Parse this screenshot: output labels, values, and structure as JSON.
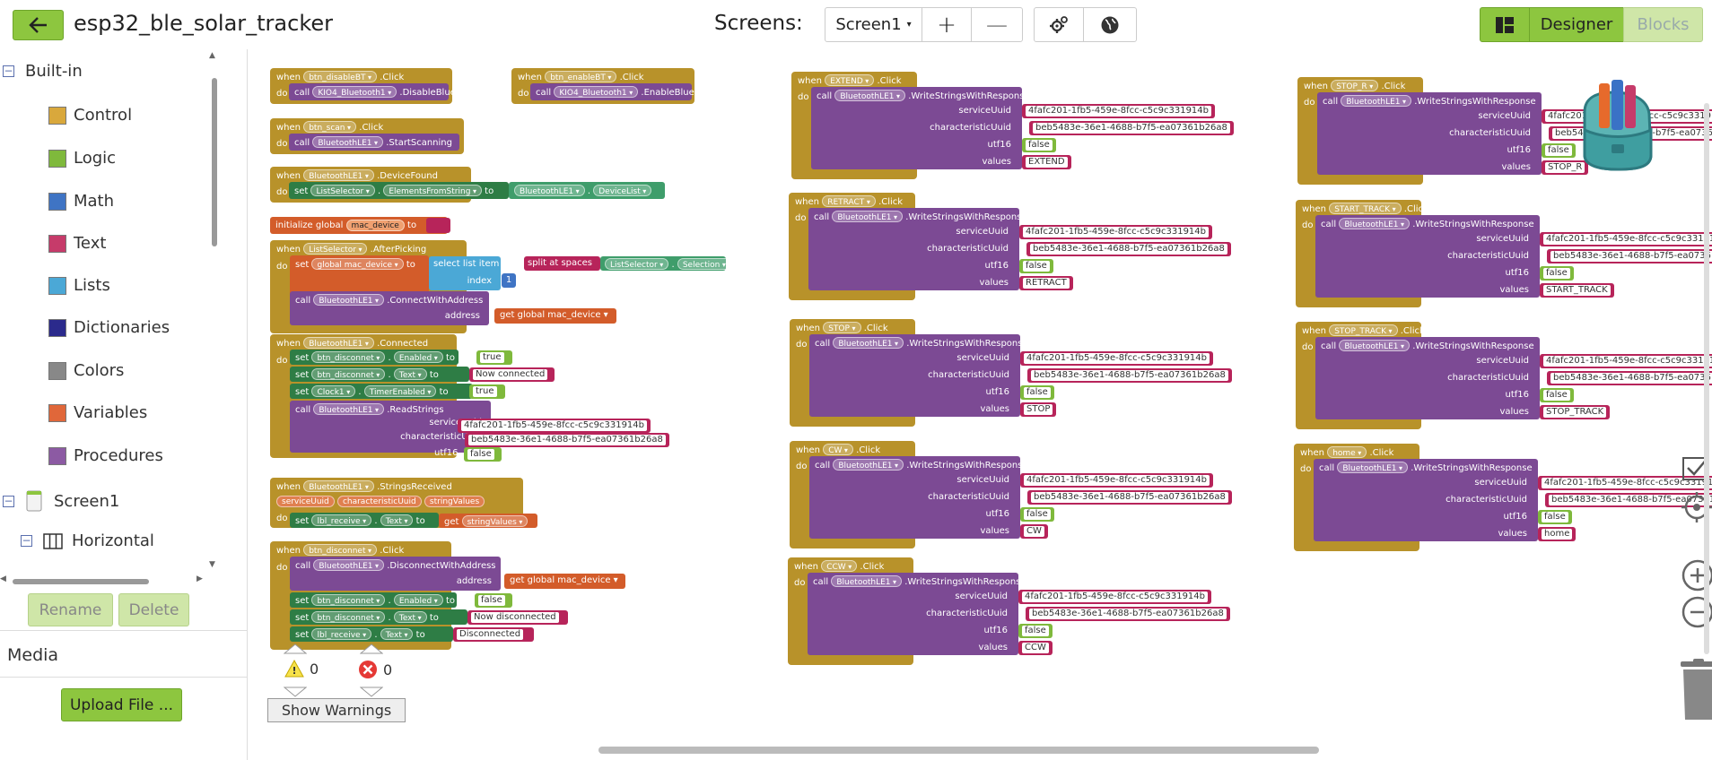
{
  "app": {
    "title": "esp32_ble_solar_tracker",
    "screens_label": "Screens:",
    "current_screen": "Screen1",
    "designer_label": "Designer",
    "blocks_label": "Blocks"
  },
  "sidebar": {
    "builtin_label": "Built-in",
    "categories": [
      {
        "label": "Control",
        "color": "#d9a83c"
      },
      {
        "label": "Logic",
        "color": "#7fb93c"
      },
      {
        "label": "Math",
        "color": "#3f74c4"
      },
      {
        "label": "Text",
        "color": "#c63b6a"
      },
      {
        "label": "Lists",
        "color": "#4ba8d6"
      },
      {
        "label": "Dictionaries",
        "color": "#2b2a8c"
      },
      {
        "label": "Colors",
        "color": "#888888"
      },
      {
        "label": "Variables",
        "color": "#e0673a"
      },
      {
        "label": "Procedures",
        "color": "#8c5aa3"
      }
    ],
    "screen_node": "Screen1",
    "horizontal_node": "Horizontal",
    "rename_label": "Rename",
    "delete_label": "Delete",
    "media_label": "Media",
    "upload_label": "Upload File ..."
  },
  "warnings": {
    "warning_count": "0",
    "error_count": "0",
    "show_label": "Show Warnings"
  },
  "blocks": {
    "common": {
      "when": "when",
      "do": "do",
      "call": "call",
      "set": "set",
      "to": "to",
      "service_uuid": "serviceUuid",
      "characteristic_uuid": "characteristicUuid",
      "utf16": "utf16",
      "values": "values",
      "address": "address",
      "uuid1": "4fafc201-1fb5-459e-8fcc-c5c9c331914b",
      "uuid2": "beb5483e-36e1-4688-b7f5-ea07361b26a8",
      "false": "false",
      "true": "true",
      "write_method": ".WriteStringsWithResponse",
      "ble": "BluetoothLE1",
      "click": ".Click"
    },
    "disable_bt": {
      "button": "btn_disableBT",
      "target": "KIO4_Bluetooth1",
      "method": ".DisableBluetooth"
    },
    "enable_bt": {
      "button": "btn_enableBT",
      "target": "KIO4_Bluetooth1",
      "method": ".EnableBluetooth"
    },
    "scan": {
      "button": "btn_scan",
      "method": ".StartScanning"
    },
    "device_found": {
      "event": ".DeviceFound",
      "component": "ListSelector",
      "property": "ElementsFromString",
      "prop": "DeviceList"
    },
    "init_global": {
      "label": "initialize global",
      "name": "mac_device",
      "to": "to"
    },
    "after_picking": {
      "event": ".AfterPicking",
      "component": "ListSelector",
      "set_var": "global mac_device",
      "select_item": "select list item  list",
      "split": "split at spaces",
      "prop": "Selection",
      "index_label": "index",
      "index_value": "1",
      "connect": ".ConnectWithAddress",
      "get_var": "get  global mac_device"
    },
    "connected": {
      "event": ".Connected",
      "c1": "btn_disconnet",
      "p1": "Enabled",
      "v1": "true",
      "c2": "btn_disconnet",
      "p2": "Text",
      "v2": "Now connected",
      "c3": "Clock1",
      "p3": "TimerEnabled",
      "v3": "true",
      "read": ".ReadStrings"
    },
    "strings_received": {
      "event": ".StringsReceived",
      "param1": "serviceUuid",
      "param2": "characteristicUuid",
      "param3": "stringValues",
      "c1": "lbl_receive",
      "p1": "Text",
      "get": "get",
      "v1": "stringValues"
    },
    "disconnect": {
      "button": "btn_disconnet",
      "method": ".DisconnectWithAddress",
      "get_var": "get  global mac_device",
      "c1": "btn_disconnet",
      "p1": "Enabled",
      "v1": "false",
      "c2": "btn_disconnet",
      "p2": "Text",
      "v2": "Now disconnected",
      "c3": "lbl_receive",
      "p3": "Text",
      "v3": "Disconnected"
    },
    "write_events": [
      {
        "button": "EXTEND",
        "value": "EXTEND"
      },
      {
        "button": "RETRACT",
        "value": "RETRACT"
      },
      {
        "button": "STOP",
        "value": "STOP"
      },
      {
        "button": "CW",
        "value": "CW"
      },
      {
        "button": "CCW",
        "value": "CCW"
      },
      {
        "button": "STOP_R",
        "value": "STOP_R"
      },
      {
        "button": "START_TRACK",
        "value": "START_TRACK"
      },
      {
        "button": "STOP_TRACK",
        "value": "STOP_TRACK"
      },
      {
        "button": "home",
        "value": "home"
      }
    ]
  }
}
